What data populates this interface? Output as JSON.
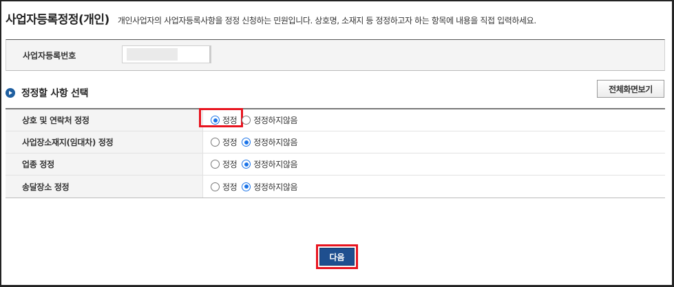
{
  "header": {
    "title": "사업자등록정정(개인)",
    "description": "개인사업자의 사업자등록사항을 정정 신청하는 민원입니다. 상호명, 소재지 등 정정하고자 하는 항목에 내용을 직접 입력하세요."
  },
  "registration": {
    "label": "사업자등록번호"
  },
  "section": {
    "title": "정정할 사항 선택",
    "fullscreen_label": "전체화면보기"
  },
  "options": [
    {
      "label": "상호 및 연락처 정정",
      "correct": "정정",
      "no_correct": "정정하지않음",
      "selected": "correct"
    },
    {
      "label": "사업장소재지(임대차) 정정",
      "correct": "정정",
      "no_correct": "정정하지않음",
      "selected": "no_correct"
    },
    {
      "label": "업종 정정",
      "correct": "정정",
      "no_correct": "정정하지않음",
      "selected": "no_correct"
    },
    {
      "label": "송달장소 정정",
      "correct": "정정",
      "no_correct": "정정하지않음",
      "selected": "no_correct"
    }
  ],
  "footer": {
    "next_label": "다음"
  },
  "colors": {
    "accent": "#1a73e8",
    "button": "#1f4f8f",
    "highlight": "#e8131e"
  }
}
